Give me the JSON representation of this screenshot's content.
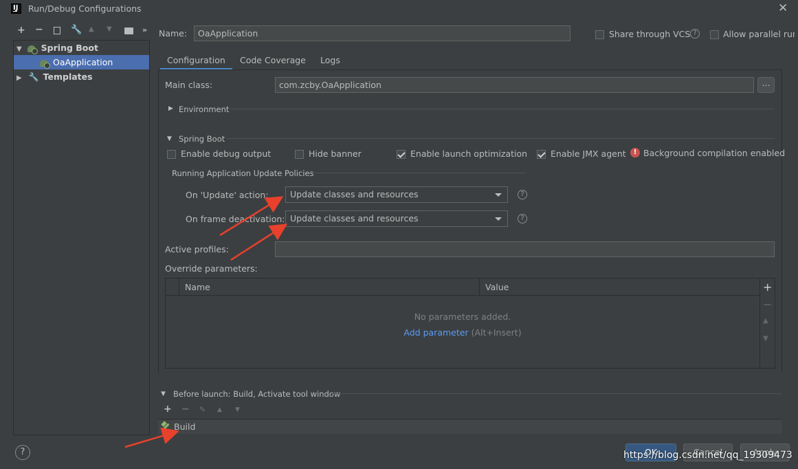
{
  "window": {
    "title": "Run/Debug Configurations",
    "logo_text": "IJ"
  },
  "toolbar": {
    "icons": [
      "add-icon",
      "remove-icon",
      "copy-icon",
      "wrench-icon",
      "move-up-icon",
      "move-down-icon",
      "new-folder-icon",
      "expand-icon"
    ]
  },
  "tree": {
    "items": [
      {
        "label": "Spring Boot",
        "level": 0,
        "expanded": true
      },
      {
        "label": "OaApplication",
        "level": 1,
        "selected": true
      },
      {
        "label": "Templates",
        "level": 0,
        "expanded": false
      }
    ]
  },
  "header": {
    "name_label": "Name:",
    "name_value": "OaApplication",
    "share_vcs": "Share through VCS",
    "allow_parallel": "Allow parallel run"
  },
  "tabs": [
    {
      "label": "Configuration",
      "active": true
    },
    {
      "label": "Code Coverage"
    },
    {
      "label": "Logs"
    }
  ],
  "config": {
    "main_class_label": "Main class:",
    "main_class_value": "com.zcby.OaApplication",
    "browse_label": "...",
    "environment_label": "Environment",
    "spring_boot_label": "Spring Boot",
    "checkboxes": [
      {
        "label": "Enable debug output",
        "checked": false
      },
      {
        "label": "Hide banner",
        "checked": false
      },
      {
        "label": "Enable launch optimization",
        "checked": true
      },
      {
        "label": "Enable JMX agent",
        "checked": true
      }
    ],
    "bg_compilation": "Background compilation enabled",
    "update_policies_label": "Running Application Update Policies",
    "on_update_label": "On 'Update' action:",
    "on_update_value": "Update classes and resources",
    "on_frame_label": "On frame deactivation:",
    "on_frame_value": "Update classes and resources",
    "active_profiles_label": "Active profiles:",
    "active_profiles_value": "",
    "override_label": "Override parameters:",
    "table_headers": [
      "Name",
      "Value"
    ],
    "no_params": "No parameters added.",
    "add_param_link": "Add parameter",
    "add_param_shortcut": "(Alt+Insert)"
  },
  "before_launch": {
    "label": "Before launch: Build, Activate tool window",
    "tasks": [
      "Build"
    ]
  },
  "buttons": {
    "ok": "OK",
    "cancel": "Cancel",
    "apply": "Apply"
  },
  "watermark": "https://blog.csdn.net/qq_19309473",
  "colors": {
    "accent": "#4a88c7",
    "selection": "#4b6eaf",
    "link": "#589df6",
    "error": "#c75450",
    "arrow": "#e8412c"
  }
}
